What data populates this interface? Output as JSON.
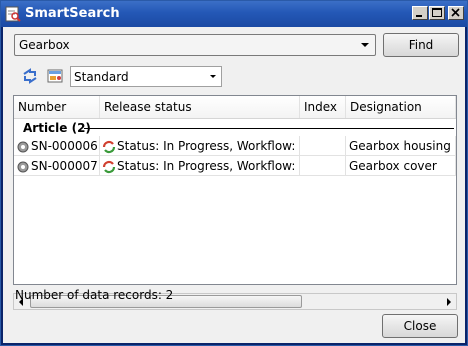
{
  "window": {
    "title": "SmartSearch"
  },
  "search": {
    "query": "Gearbox",
    "find_label": "Find"
  },
  "toolbar": {
    "view_value": "Standard"
  },
  "grid": {
    "columns": [
      "Number",
      "Release status",
      "Index",
      "Designation"
    ],
    "group_label": "Article (2)",
    "rows": [
      {
        "number": "SN-000006",
        "release_status": "Status: In Progress, Workflow: part",
        "index": "",
        "designation": "Gearbox housing"
      },
      {
        "number": "SN-000007",
        "release_status": "Status: In Progress, Workflow: part",
        "index": "",
        "designation": "Gearbox cover"
      }
    ]
  },
  "status_bar": {
    "text": "Number of data records: 2"
  },
  "footer": {
    "close_label": "Close"
  },
  "colors": {
    "title_bar": "#1b4aa3",
    "accent": "#2458b6"
  }
}
